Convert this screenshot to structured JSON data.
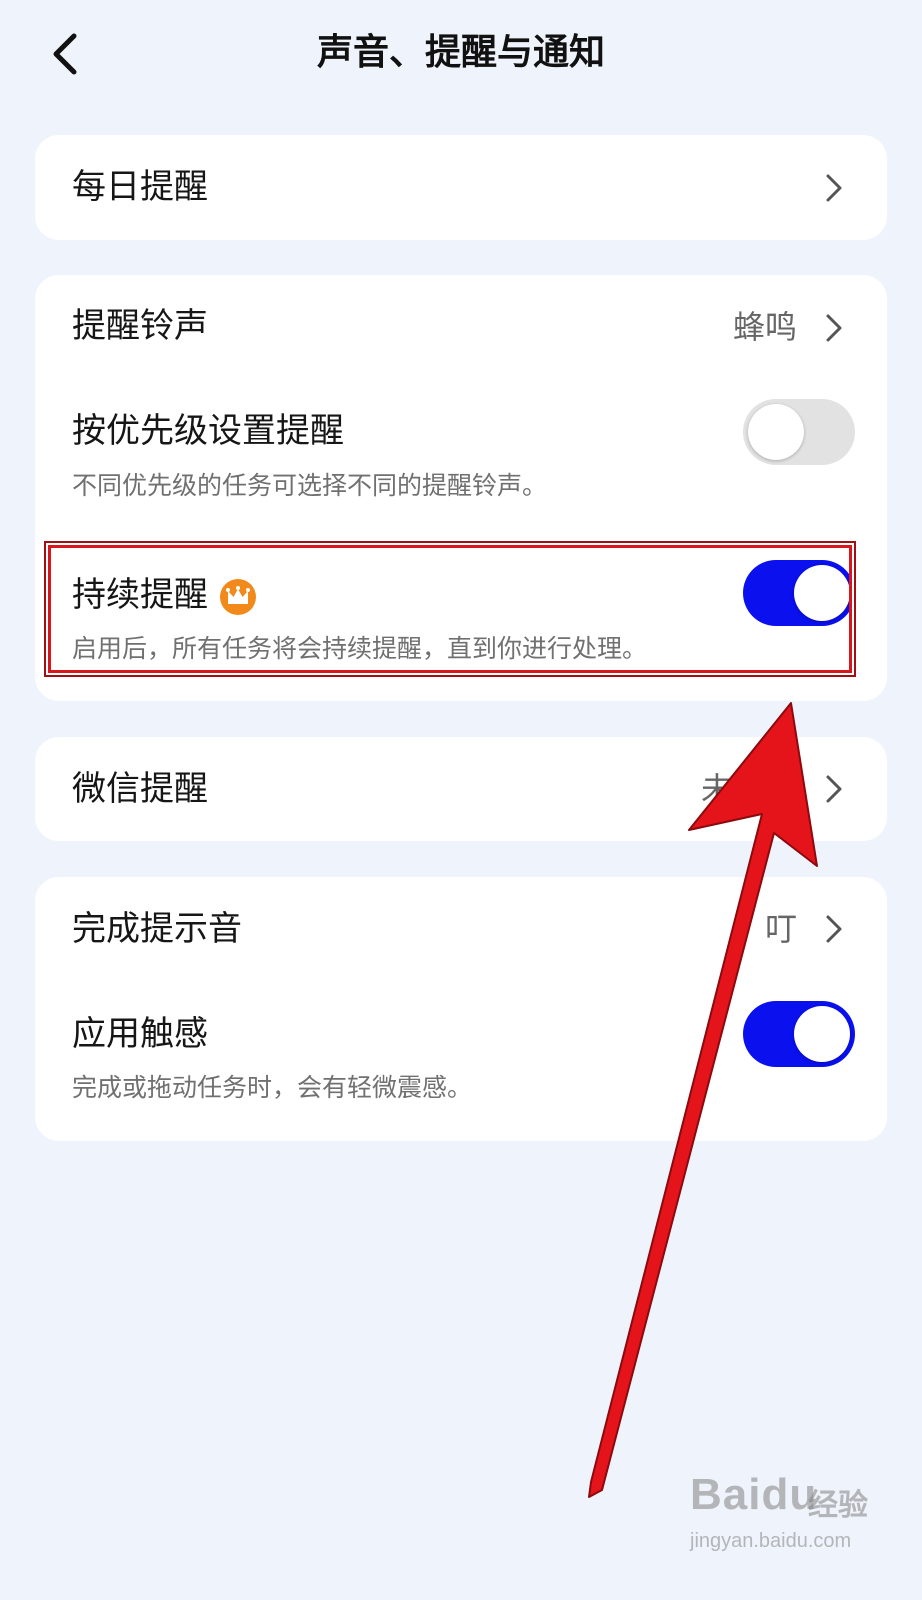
{
  "header": {
    "title": "声音、提醒与通知",
    "back_icon": "chevron-left-icon"
  },
  "daily_card": {
    "daily_reminder_label": "每日提醒"
  },
  "reminder_card": {
    "ringtone_label": "提醒铃声",
    "ringtone_value": "蜂鸣",
    "priority_label": "按优先级设置提醒",
    "priority_desc": "不同优先级的任务可选择不同的提醒铃声。",
    "priority_toggle": "off",
    "continuous_label": "持续提醒",
    "continuous_badge_icon": "crown-icon",
    "continuous_desc": "启用后，所有任务将会持续提醒，直到你进行处理。",
    "continuous_toggle": "on"
  },
  "wechat_card": {
    "wechat_label": "微信提醒",
    "wechat_value": "未开启"
  },
  "completion_card": {
    "sound_label": "完成提示音",
    "sound_value": "叮",
    "haptic_label": "应用触感",
    "haptic_desc": "完成或拖动任务时，会有轻微震感。",
    "haptic_toggle": "on"
  },
  "colors": {
    "background": "#eff4fc",
    "toggle_on": "#0a10ee",
    "toggle_off": "#e2e2e2",
    "crown_badge": "#f28a1b",
    "annotation_red": "#e5141b"
  },
  "watermark": {
    "logo": "Baidu",
    "text": "经验",
    "url": "jingyan.baidu.com"
  }
}
